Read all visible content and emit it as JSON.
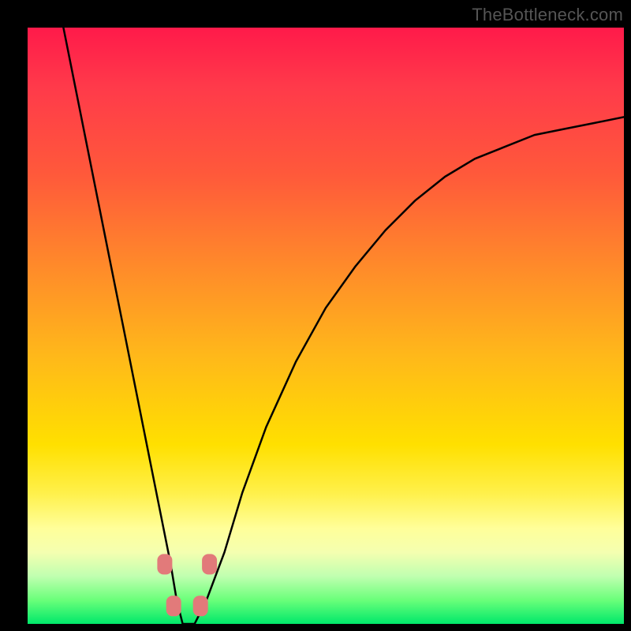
{
  "attribution": "TheBottleneck.com",
  "colors": {
    "frame_background": "#000000",
    "gradient_top": "#ff1a4a",
    "gradient_mid1": "#ff8a2a",
    "gradient_mid2": "#ffe000",
    "gradient_bottom": "#00e86a",
    "curve_stroke": "#000000",
    "marker_fill": "#e27a7a",
    "marker_stroke": "#b85a5a"
  },
  "chart_data": {
    "type": "line",
    "title": "",
    "xlabel": "",
    "ylabel": "",
    "xlim": [
      0,
      100
    ],
    "ylim": [
      0,
      100
    ],
    "grid": false,
    "legend": false,
    "annotations": [
      "TheBottleneck.com"
    ],
    "series": [
      {
        "name": "bottleneck-curve",
        "x": [
          6,
          8,
          10,
          12,
          14,
          16,
          18,
          20,
          22,
          24,
          25,
          26,
          28,
          30,
          33,
          36,
          40,
          45,
          50,
          55,
          60,
          65,
          70,
          75,
          80,
          85,
          90,
          95,
          100
        ],
        "y": [
          100,
          90,
          80,
          70,
          60,
          50,
          40,
          30,
          20,
          10,
          4,
          0,
          0,
          4,
          12,
          22,
          33,
          44,
          53,
          60,
          66,
          71,
          75,
          78,
          80,
          82,
          83,
          84,
          85
        ]
      }
    ],
    "markers": [
      {
        "x": 23.0,
        "y": 10
      },
      {
        "x": 30.5,
        "y": 10
      },
      {
        "x": 24.5,
        "y": 3
      },
      {
        "x": 29.0,
        "y": 3
      }
    ],
    "optimal_x": 27
  }
}
